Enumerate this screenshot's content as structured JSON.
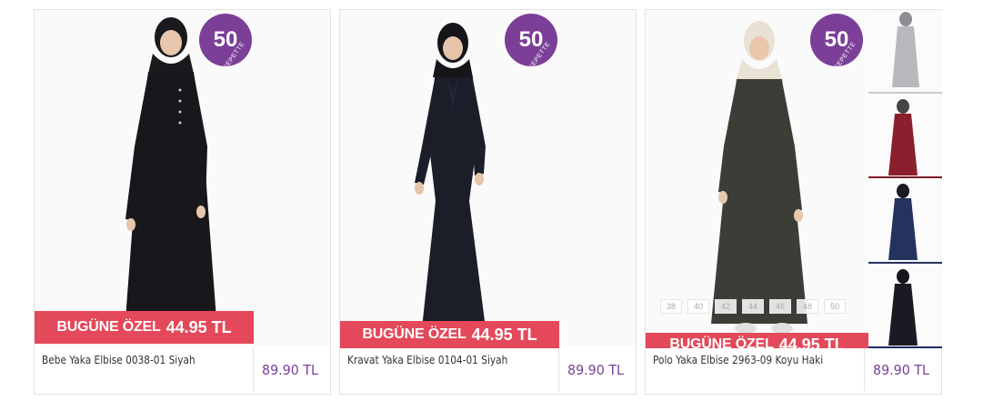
{
  "products": [
    {
      "badge_number": "50",
      "badge_text": "SEPETTE",
      "ribbon_label": "BUGÜNE ÖZEL",
      "ribbon_price": "44.95 TL",
      "name": "Bebe Yaka Elbise 0038-01 Siyah",
      "old_price": "89.90 TL",
      "dress_color": "#17171c"
    },
    {
      "badge_number": "50",
      "badge_text": "SEPETTE",
      "ribbon_label": "BUGÜNE ÖZEL",
      "ribbon_price": "44.95 TL",
      "name": "Kravat Yaka Elbise 0104-01 Siyah",
      "old_price": "89.90 TL",
      "dress_color": "#1b1d29"
    },
    {
      "badge_number": "50",
      "badge_text": "SEPETTE",
      "ribbon_label": "BUGÜNE ÖZEL",
      "ribbon_price": "44.95 TL",
      "name": "Polo Yaka Elbise 2963-09 Koyu Haki",
      "old_price": "89.90 TL",
      "dress_color": "#3b3e36",
      "sizes": [
        "38",
        "40",
        "42",
        "44",
        "46",
        "48",
        "50"
      ],
      "color_variants": [
        {
          "name": "gray-variant",
          "color": "#b9b9bd",
          "bar": "#c9c9c9"
        },
        {
          "name": "bordo-variant",
          "color": "#8a1f2d",
          "bar": "#7a1926"
        },
        {
          "name": "navy-variant",
          "color": "#26325e",
          "bar": "#26325e"
        },
        {
          "name": "black-variant",
          "color": "#1a1a22",
          "bar": "#1c2a6a"
        }
      ]
    }
  ],
  "colors": {
    "badge": "#7b3f98",
    "ribbon": "#e3495a",
    "price": "#7b3f98"
  }
}
